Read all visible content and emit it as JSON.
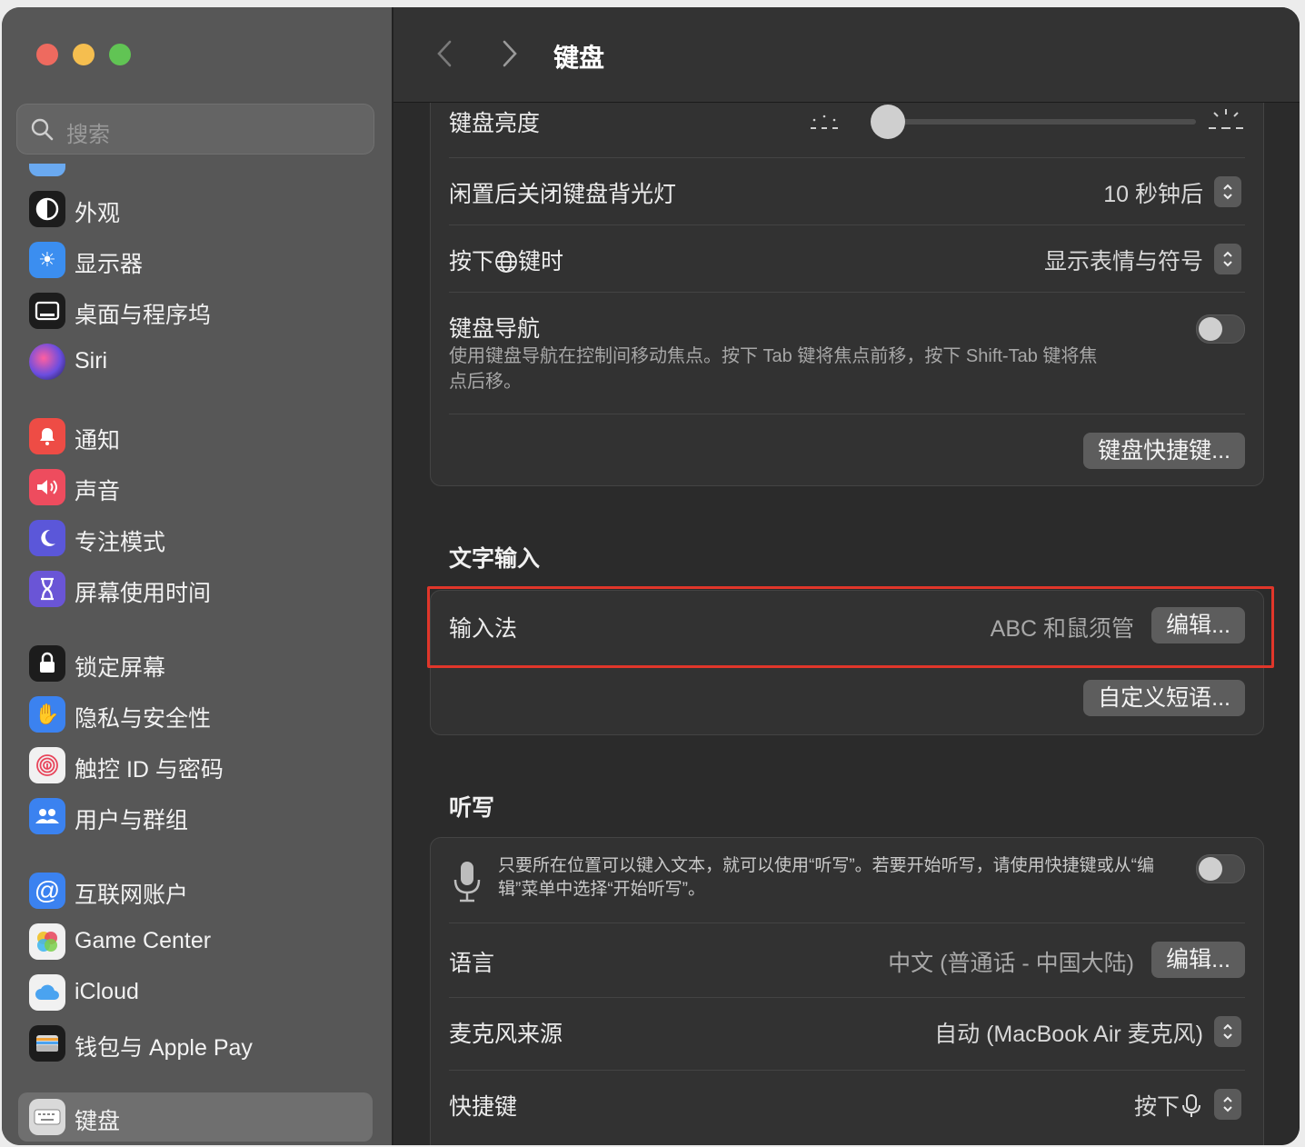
{
  "sidebar": {
    "search_placeholder": "搜索",
    "items": [
      {
        "label": "外观",
        "icon": "appearance-icon",
        "color": "#1c1c1c"
      },
      {
        "label": "显示器",
        "icon": "display-icon",
        "color": "#3b8ef0"
      },
      {
        "label": "桌面与程序坞",
        "icon": "dock-icon",
        "color": "#1c1c1c"
      },
      {
        "label": "Siri",
        "icon": "siri-icon",
        "color": "#7a4fd0"
      },
      {
        "label": "通知",
        "icon": "bell-icon",
        "color": "#ee4c45"
      },
      {
        "label": "声音",
        "icon": "speaker-icon",
        "color": "#ee4c5e"
      },
      {
        "label": "专注模式",
        "icon": "moon-icon",
        "color": "#5b57d9"
      },
      {
        "label": "屏幕使用时间",
        "icon": "hourglass-icon",
        "color": "#6a55d6"
      },
      {
        "label": "锁定屏幕",
        "icon": "lock-icon",
        "color": "#1c1c1c"
      },
      {
        "label": "隐私与安全性",
        "icon": "hand-icon",
        "color": "#3b82f0"
      },
      {
        "label": "触控 ID 与密码",
        "icon": "fingerprint-icon",
        "color": "#f1f1f1"
      },
      {
        "label": "用户与群组",
        "icon": "users-icon",
        "color": "#3b82f0"
      },
      {
        "label": "互联网账户",
        "icon": "at-icon",
        "color": "#3b82f0"
      },
      {
        "label": "Game Center",
        "icon": "game-center-icon",
        "color": "#f1f1f1"
      },
      {
        "label": "iCloud",
        "icon": "cloud-icon",
        "color": "#f1f1f1"
      },
      {
        "label": "钱包与 Apple Pay",
        "icon": "wallet-icon",
        "color": "#1c1c1c"
      },
      {
        "label": "键盘",
        "icon": "keyboard-icon",
        "color": "#d9d9d9"
      }
    ]
  },
  "header": {
    "title": "键盘",
    "back_icon": "chevron-left-icon",
    "forward_icon": "chevron-right-icon"
  },
  "keyboard": {
    "brightness_label": "键盘亮度",
    "brightness_level": 0.05,
    "backlight_off_label": "闲置后关闭键盘背光灯",
    "backlight_off_value": "10 秒钟后",
    "globe_key_label_before": "按下",
    "globe_key_label_after": "键时",
    "globe_key_value": "显示表情与符号",
    "nav_label": "键盘导航",
    "nav_desc": "使用键盘导航在控制间移动焦点。按下 Tab 键将焦点前移，按下 Shift-Tab 键将焦点后移。",
    "nav_enabled": false,
    "shortcuts_button": "键盘快捷键..."
  },
  "text_input": {
    "section_title": "文字输入",
    "input_label": "输入法",
    "input_value": "ABC 和鼠须管",
    "edit_button": "编辑...",
    "text_replacements_button": "自定义短语..."
  },
  "dictation": {
    "section_title": "听写",
    "desc": "只要所在位置可以键入文本，就可以使用“听写”。若要开始听写，请使用快捷键或从“编辑”菜单中选择“开始听写”。",
    "enabled": false,
    "language_label": "语言",
    "language_value": "中文 (普通话 - 中国大陆)",
    "language_edit_button": "编辑...",
    "mic_label": "麦克风来源",
    "mic_value": "自动 (MacBook Air 麦克风)",
    "shortcut_label": "快捷键",
    "shortcut_value": "按下"
  },
  "colors": {
    "highlight": "#e1362a",
    "window_bg": "#2b2b2b",
    "sidebar_bg": "#575757"
  }
}
